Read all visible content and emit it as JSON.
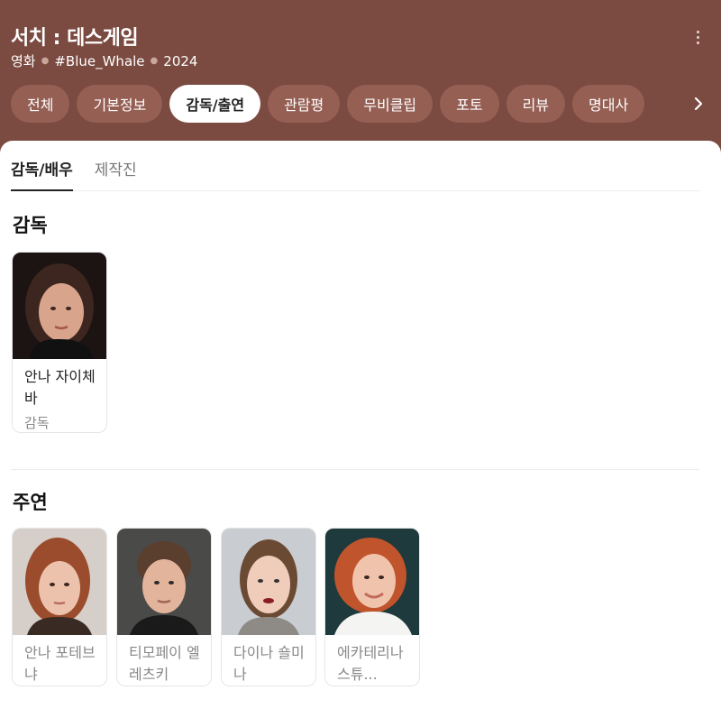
{
  "header": {
    "title": "서치 : 데스게임",
    "meta": [
      "영화",
      "#Blue_Whale",
      "2024"
    ]
  },
  "tabs": [
    {
      "label": "전체"
    },
    {
      "label": "기본정보"
    },
    {
      "label": "감독/출연"
    },
    {
      "label": "관람평"
    },
    {
      "label": "무비클립"
    },
    {
      "label": "포토"
    },
    {
      "label": "리뷰"
    },
    {
      "label": "명대사"
    }
  ],
  "active_tab": "감독/출연",
  "subtabs": [
    {
      "label": "감독/배우"
    },
    {
      "label": "제작진"
    }
  ],
  "director_section": {
    "title": "감독",
    "people": [
      {
        "name": "안나 자이체바",
        "role": "감독"
      }
    ]
  },
  "cast_section": {
    "title": "주연",
    "people": [
      {
        "name": "안나 포테브냐"
      },
      {
        "name": "티모페이 엘레츠키"
      },
      {
        "name": "다이나 숄미나"
      },
      {
        "name": "에카테리나 스튜..."
      }
    ]
  },
  "colors": {
    "header_bg": "#7b4a40",
    "tab_bg": "#955f54",
    "active_tab_bg": "#ffffff"
  }
}
